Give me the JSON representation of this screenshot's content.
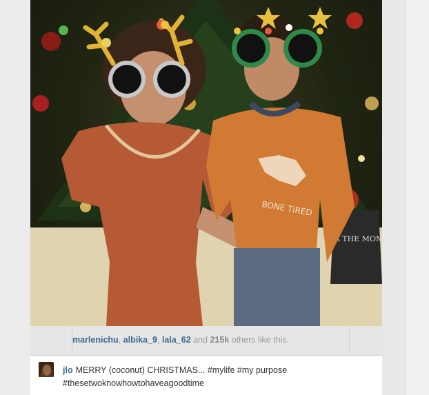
{
  "post": {
    "likes": {
      "users": [
        "marlenichu",
        "albika_9",
        "lala_62"
      ],
      "sep1": ", ",
      "sep2": ", ",
      "and_text": " and ",
      "count": "215k",
      "suffix": " others like this."
    },
    "caption": {
      "author": "jlo",
      "line1": "MERRY (coconut) CHRISTMAS... #mylife #my purpose",
      "line2": "#thesetwoknowhowtohaveagoodtime"
    },
    "photo": {
      "shirt_text": "BONE TIRED",
      "bag_text": "SAVOR THE MOMENT"
    }
  }
}
